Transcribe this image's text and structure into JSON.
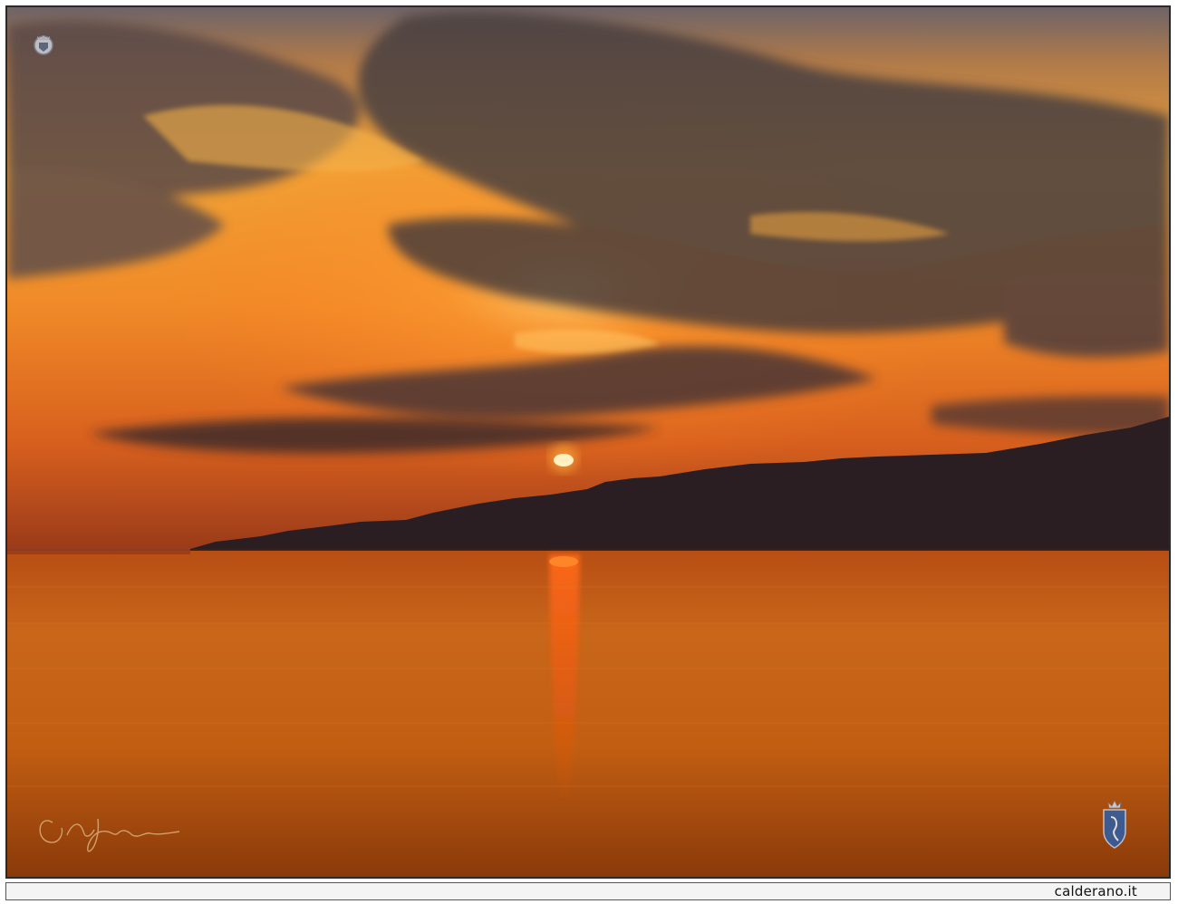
{
  "photo": {
    "subject": "sunset-over-sea",
    "colors": {
      "sky_top": "#5a5a62",
      "sky_glow": "#f0a030",
      "horizon_glow": "#e86a18",
      "sun": "#fff2c0",
      "mountains": "#2a1e22",
      "sea": "#c86410",
      "frame_border": "#2a2a2a"
    }
  },
  "watermarks": {
    "top_left_emblem": "crest-logo",
    "bottom_left_signature": "handwritten-signature",
    "bottom_right_emblem": "shield-logo"
  },
  "footer": {
    "site_label": "calderano.it"
  }
}
